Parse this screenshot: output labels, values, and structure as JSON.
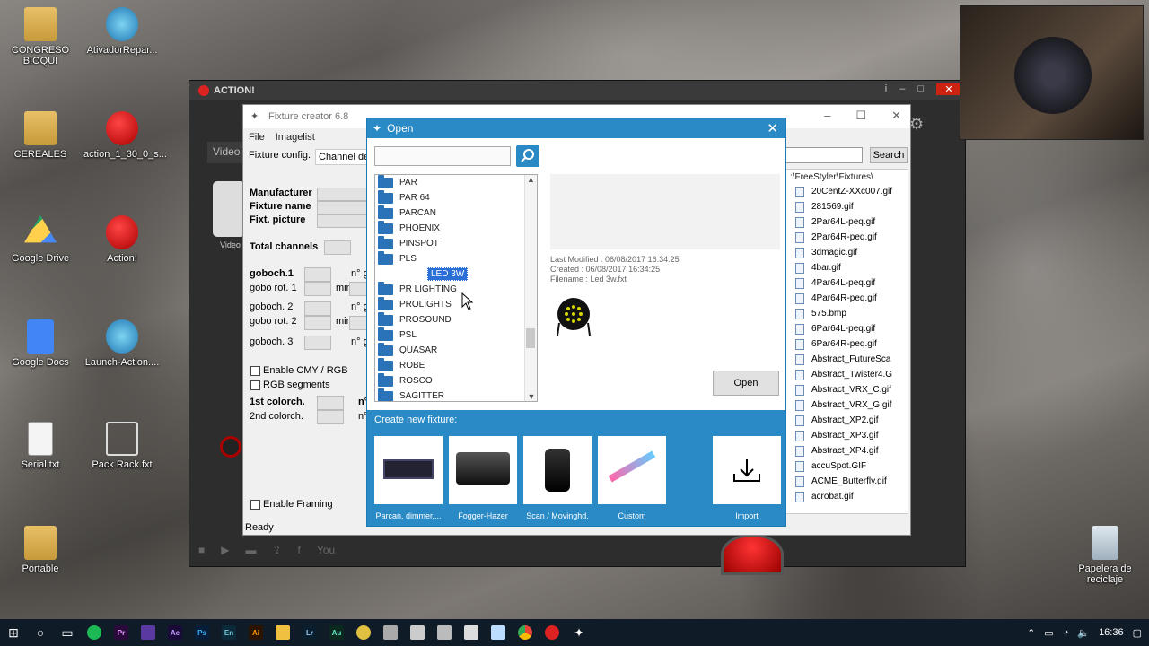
{
  "desktop": {
    "icons": [
      {
        "label": "CONGRESO BIOQUI"
      },
      {
        "label": "AtivadorRepar..."
      },
      {
        "label": "CEREALES"
      },
      {
        "label": "action_1_30_0_s..."
      },
      {
        "label": "Google Drive"
      },
      {
        "label": "Action!"
      },
      {
        "label": "Google Docs"
      },
      {
        "label": "Launch-Action...."
      },
      {
        "label": "Serial.txt"
      },
      {
        "label": "Pack Rack.fxt"
      },
      {
        "label": "Portable"
      },
      {
        "label": "Papelera de reciclaje"
      }
    ]
  },
  "action_window": {
    "title": "ACTION!",
    "video_tab": "Video",
    "video_label": "Video"
  },
  "fixture_creator": {
    "title": "Fixture creator 6.8",
    "menu": [
      "File",
      "Imagelist"
    ],
    "fixture_config": "Fixture config.",
    "channel_tab": "Channel des",
    "manufacturer": "Manufacturer",
    "fixture_name": "Fixture name",
    "fixt_picture": "Fixt. picture",
    "total_channels": "Total channels",
    "goboch1": "goboch.1",
    "gobo_rot1": "gobo rot. 1",
    "goboch2": "goboch. 2",
    "gobo_rot2": "gobo rot. 2",
    "goboch3": "goboch. 3",
    "ng": "n° g",
    "min": "min",
    "enable_cmy": "Enable CMY / RGB",
    "rgb_segments": "RGB segments",
    "colorch1": "1st colorch.",
    "colorch2": "2nd colorch.",
    "n_label": "n°",
    "enable_framing": "Enable Framing",
    "status": "Ready",
    "search_button": "Search",
    "path": ":\\FreeStyler\\Fixtures\\",
    "files": [
      "20CentZ-XXc007.gif",
      "281569.gif",
      "2Par64L-peq.gif",
      "2Par64R-peq.gif",
      "3dmagic.gif",
      "4bar.gif",
      "4Par64L-peq.gif",
      "4Par64R-peq.gif",
      "575.bmp",
      "6Par64L-peq.gif",
      "6Par64R-peq.gif",
      "Abstract_FutureSca",
      "Abstract_Twister4.G",
      "Abstract_VRX_C.gif",
      "Abstract_VRX_G.gif",
      "Abstract_XP2.gif",
      "Abstract_XP3.gif",
      "Abstract_XP4.gif",
      "accuSpot.GIF",
      "ACME_Butterfly.gif",
      "acrobat.gif"
    ]
  },
  "open_dialog": {
    "title": "Open",
    "search_placeholder": "",
    "folders_before": [
      "PAR",
      "PAR 64",
      "PARCAN",
      "PHOENIX",
      "PINSPOT",
      "PLS"
    ],
    "selected_file": "LED 3W",
    "folders_after": [
      "PR LIGHTING",
      "PROLIGHTS",
      "PROSOUND",
      "PSL",
      "QUASAR",
      "ROBE",
      "ROSCO",
      "SAGITTER"
    ],
    "last_modified": "Last Modified : 06/08/2017 16:34:25",
    "created": "Created : 06/08/2017 16:34:25",
    "filename": "Filename : Led 3w.fxt",
    "open_button": "Open",
    "create_label": "Create new fixture:",
    "tiles": [
      "Parcan, dimmer,...",
      "Fogger-Hazer",
      "Scan / Movinghd.",
      "Custom",
      "Import"
    ]
  },
  "taskbar": {
    "time": "16:36",
    "apps": [
      "Pr",
      "Ae",
      "Ps",
      "En",
      "Ai",
      "Lr",
      "Au"
    ]
  },
  "colors": {
    "accent": "#2a8ac6",
    "taskbar": "#101b28"
  }
}
